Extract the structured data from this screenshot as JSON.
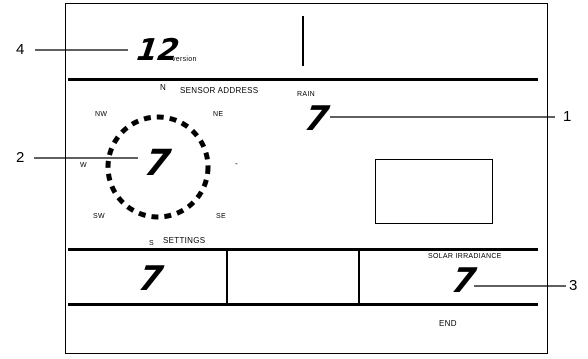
{
  "callouts": [
    {
      "number": "4"
    },
    {
      "number": "1"
    },
    {
      "number": "2"
    },
    {
      "number": "3"
    }
  ],
  "version": {
    "value": "12",
    "label": "version"
  },
  "compass": {
    "n": "N",
    "ne": "NE",
    "nw": "NW",
    "w": "W",
    "e": "-",
    "sw": "SW",
    "se": "SE",
    "s": "S",
    "value": "7"
  },
  "sensor": {
    "label": "SENSOR ADDRESS",
    "rain_label": "RAIN",
    "rain_value": "7"
  },
  "settings": {
    "label": "SETTINGS"
  },
  "bottom": {
    "left_value": "7",
    "solar_label": "SOLAR IRRADIANCE",
    "solar_value": "7",
    "end_label": "END"
  }
}
